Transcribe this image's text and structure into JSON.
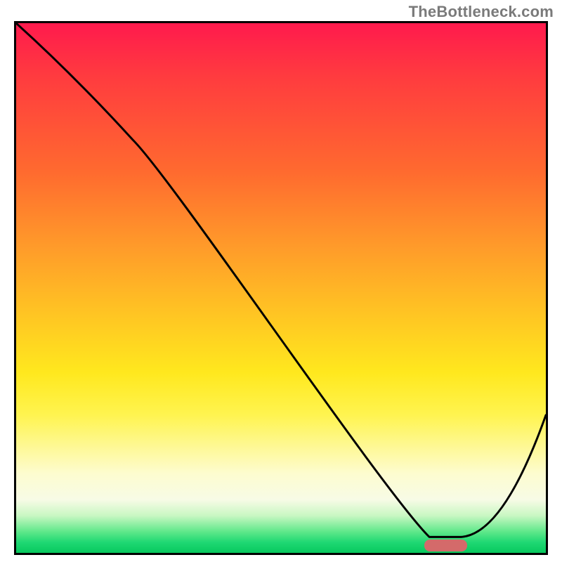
{
  "watermark": "TheBottleneck.com",
  "chart_data": {
    "type": "line",
    "title": "",
    "xlabel": "",
    "ylabel": "",
    "xlim": [
      0,
      100
    ],
    "ylim": [
      0,
      100
    ],
    "grid": false,
    "legend": false,
    "series": [
      {
        "name": "bottleneck-curve",
        "color": "#000000",
        "x": [
          0,
          22,
          78,
          84,
          100
        ],
        "y": [
          100,
          78,
          3,
          3,
          26
        ]
      }
    ],
    "marker": {
      "name": "optimal-range",
      "color": "#d46a6a",
      "x_start": 76.5,
      "x_end": 84.5,
      "y": 2.2,
      "height": 2.2
    },
    "gradient_stops": [
      {
        "pos": 0,
        "color": "#ff1a4d"
      },
      {
        "pos": 10,
        "color": "#ff3b3f"
      },
      {
        "pos": 28,
        "color": "#ff6a2f"
      },
      {
        "pos": 42,
        "color": "#ff9a2a"
      },
      {
        "pos": 55,
        "color": "#ffc523"
      },
      {
        "pos": 66,
        "color": "#ffe81e"
      },
      {
        "pos": 74,
        "color": "#fff450"
      },
      {
        "pos": 85,
        "color": "#fdfccf"
      },
      {
        "pos": 90,
        "color": "#f7fbe6"
      },
      {
        "pos": 93,
        "color": "#c8f7c2"
      },
      {
        "pos": 96,
        "color": "#5fe88a"
      },
      {
        "pos": 98,
        "color": "#1fd873"
      },
      {
        "pos": 100,
        "color": "#08c95e"
      }
    ]
  }
}
